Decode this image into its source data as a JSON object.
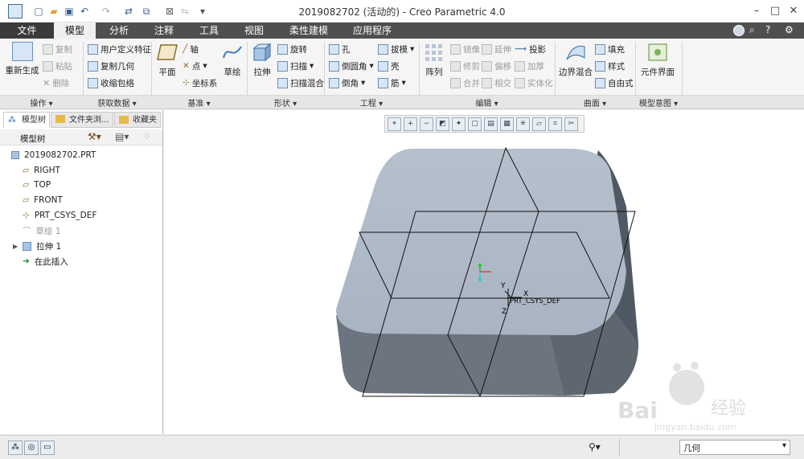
{
  "window": {
    "title": "2019082702 (活动的) - Creo Parametric 4.0"
  },
  "tabs": [
    "文件",
    "模型",
    "分析",
    "注释",
    "工具",
    "视图",
    "柔性建模",
    "应用程序"
  ],
  "ribbon": {
    "ops": {
      "regen": "重新生成",
      "copy": "复制",
      "paste": "粘贴",
      "delete": "删除",
      "label": "操作"
    },
    "getdata": {
      "udf": "用户定义特征",
      "copygeom": "复制几何",
      "shrink": "收缩包络",
      "label": "获取数据"
    },
    "datum": {
      "plane": "平面",
      "axis": "轴",
      "point": "点",
      "csys": "坐标系",
      "sketch": "草绘",
      "label": "基准"
    },
    "shapes": {
      "extrude": "拉伸",
      "revolve": "旋转",
      "sweep": "扫描",
      "swept_blend": "扫描混合",
      "label": "形状"
    },
    "eng": {
      "hole": "孔",
      "round": "倒圆角",
      "chamfer": "倒角",
      "draft": "拔模",
      "shell": "壳",
      "rib": "筋",
      "label": "工程"
    },
    "edit": {
      "pattern": "阵列",
      "mirror": "镜像",
      "extend": "延伸",
      "project": "投影",
      "trim": "修剪",
      "offset": "偏移",
      "thicken": "加厚",
      "merge": "合并",
      "intersect": "相交",
      "solidify": "实体化",
      "label": "编辑"
    },
    "surface": {
      "boundary": "边界混合",
      "fill": "填充",
      "style": "样式",
      "freestyle": "自由式",
      "label": "曲面"
    },
    "intent": {
      "component": "元件界面",
      "label": "模型意图"
    }
  },
  "left_panel": {
    "tabs": [
      "模型树",
      "文件夹浏...",
      "收藏夹"
    ],
    "tree_header": "模型树",
    "items": [
      {
        "label": "2019082702.PRT",
        "enabled": true
      },
      {
        "label": "RIGHT",
        "enabled": true
      },
      {
        "label": "TOP",
        "enabled": true
      },
      {
        "label": "FRONT",
        "enabled": true
      },
      {
        "label": "PRT_CSYS_DEF",
        "enabled": true
      },
      {
        "label": "草绘 1",
        "enabled": false
      },
      {
        "label": "拉伸 1",
        "enabled": true
      },
      {
        "label": "在此插入",
        "enabled": true
      }
    ]
  },
  "canvas": {
    "csys_label": "PRT_CSYS_DEF",
    "axis_x": "X",
    "axis_y": "Y",
    "axis_z": "Z"
  },
  "status": {
    "filter": "几何"
  },
  "watermark": {
    "brand": "Bai",
    "brand2": "经验",
    "url": "jingyan.baidu.com"
  }
}
